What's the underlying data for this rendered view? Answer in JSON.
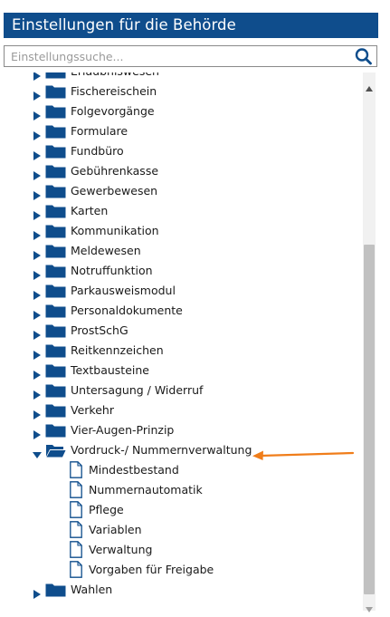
{
  "panel": {
    "title": "Einstellungen für die Behörde"
  },
  "search": {
    "placeholder": "Einstellungssuche..."
  },
  "tree": {
    "items": [
      {
        "label": "Erlaubniswesen",
        "kind": "folder",
        "expanded": false
      },
      {
        "label": "Fischereischein",
        "kind": "folder",
        "expanded": false
      },
      {
        "label": "Folgevorgänge",
        "kind": "folder",
        "expanded": false
      },
      {
        "label": "Formulare",
        "kind": "folder",
        "expanded": false
      },
      {
        "label": "Fundbüro",
        "kind": "folder",
        "expanded": false
      },
      {
        "label": "Gebührenkasse",
        "kind": "folder",
        "expanded": false
      },
      {
        "label": "Gewerbewesen",
        "kind": "folder",
        "expanded": false
      },
      {
        "label": "Karten",
        "kind": "folder",
        "expanded": false
      },
      {
        "label": "Kommunikation",
        "kind": "folder",
        "expanded": false
      },
      {
        "label": "Meldewesen",
        "kind": "folder",
        "expanded": false
      },
      {
        "label": "Notruffunktion",
        "kind": "folder",
        "expanded": false
      },
      {
        "label": "Parkausweismodul",
        "kind": "folder",
        "expanded": false
      },
      {
        "label": "Personaldokumente",
        "kind": "folder",
        "expanded": false
      },
      {
        "label": "ProstSchG",
        "kind": "folder",
        "expanded": false
      },
      {
        "label": "Reitkennzeichen",
        "kind": "folder",
        "expanded": false
      },
      {
        "label": "Textbausteine",
        "kind": "folder",
        "expanded": false
      },
      {
        "label": "Untersagung / Widerruf",
        "kind": "folder",
        "expanded": false
      },
      {
        "label": "Verkehr",
        "kind": "folder",
        "expanded": false
      },
      {
        "label": "Vier-Augen-Prinzip",
        "kind": "folder",
        "expanded": false
      },
      {
        "label": "Vordruck-/ Nummernverwaltung",
        "kind": "folder",
        "expanded": true
      },
      {
        "label": "Mindestbestand",
        "kind": "file"
      },
      {
        "label": "Nummernautomatik",
        "kind": "file"
      },
      {
        "label": "Pflege",
        "kind": "file"
      },
      {
        "label": "Variablen",
        "kind": "file"
      },
      {
        "label": "Verwaltung",
        "kind": "file"
      },
      {
        "label": "Vorgaben für Freigabe",
        "kind": "file"
      },
      {
        "label": "Wahlen",
        "kind": "folder",
        "expanded": false
      }
    ]
  },
  "colors": {
    "header_bg": "#0f4d8c",
    "folder": "#0f4d8c",
    "annotation_arrow": "#f07d1a",
    "scroll_thumb": "#c1c1c1"
  },
  "icons": {
    "search": "search-icon",
    "collapsed": "caret-right-icon",
    "expanded": "caret-down-icon",
    "folder": "folder-icon",
    "folder_open": "folder-open-icon",
    "file": "document-icon"
  }
}
